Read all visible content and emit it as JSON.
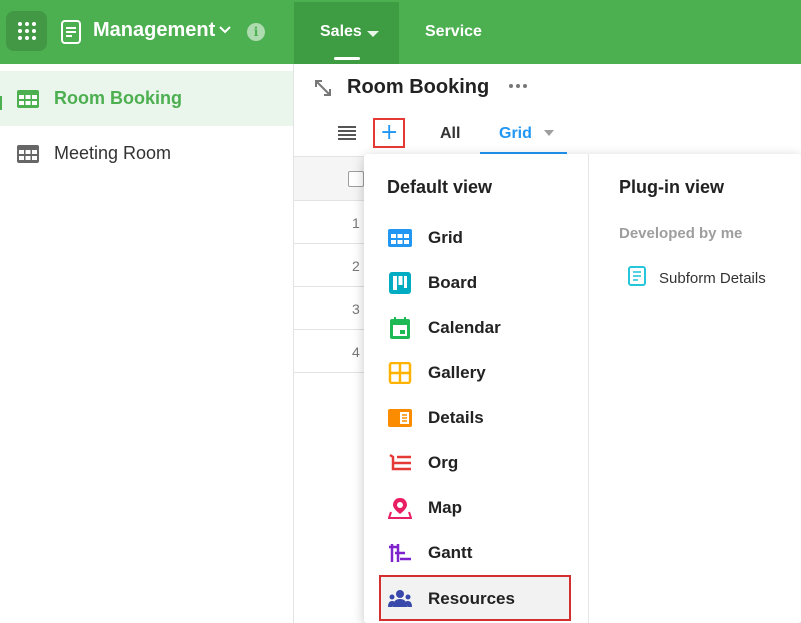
{
  "topbar": {
    "app_title": "Management",
    "tabs": [
      {
        "label": "Sales",
        "active": true
      },
      {
        "label": "Service",
        "active": false
      }
    ],
    "info_glyph": "i",
    "color": "#4caf50"
  },
  "sidebar": {
    "items": [
      {
        "label": "Room Booking",
        "icon": "grid-table-icon",
        "active": true
      },
      {
        "label": "Meeting Room",
        "icon": "grid-table-icon",
        "active": false
      }
    ]
  },
  "main": {
    "title": "Room Booking",
    "views": [
      {
        "label": "All"
      },
      {
        "label": "Grid",
        "active": true
      }
    ],
    "add_glyph": "+",
    "rows": [
      "1",
      "2",
      "3",
      "4"
    ]
  },
  "dropdown": {
    "default_header": "Default view",
    "default_items": [
      {
        "label": "Grid",
        "icon": "grid-view-icon",
        "color": "#2196f3"
      },
      {
        "label": "Board",
        "icon": "board-view-icon",
        "color": "#00acc1"
      },
      {
        "label": "Calendar",
        "icon": "calendar-view-icon",
        "color": "#1db954"
      },
      {
        "label": "Gallery",
        "icon": "gallery-view-icon",
        "color": "#ffb300"
      },
      {
        "label": "Details",
        "icon": "details-view-icon",
        "color": "#fb8c00"
      },
      {
        "label": "Org",
        "icon": "org-view-icon",
        "color": "#e53935"
      },
      {
        "label": "Map",
        "icon": "map-pin-icon",
        "color": "#e91e63"
      },
      {
        "label": "Gantt",
        "icon": "gantt-view-icon",
        "color": "#7e22ce"
      },
      {
        "label": "Resources",
        "icon": "resources-view-icon",
        "color": "#3949ab",
        "highlighted": true
      }
    ],
    "plugin_header": "Plug-in view",
    "plugin_sub": "Developed by me",
    "plugin_items": [
      {
        "label": "Subform Details",
        "icon": "document-icon",
        "color": "#26c6da"
      }
    ]
  }
}
